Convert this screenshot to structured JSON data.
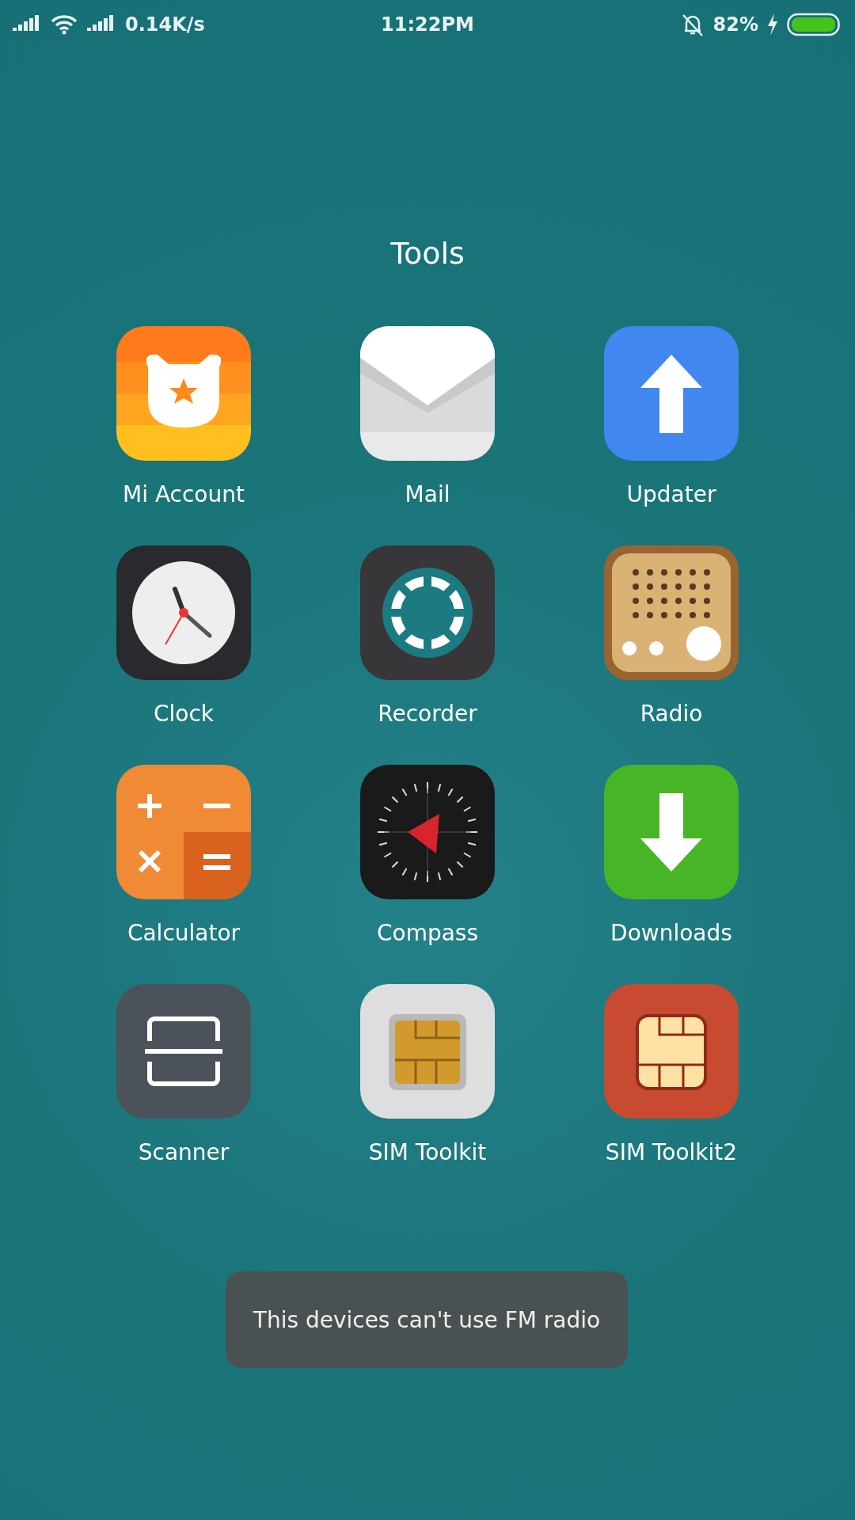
{
  "status_bar": {
    "speed": "0.14K/s",
    "time": "11:22PM",
    "battery": "82%"
  },
  "folder": {
    "title": "Tools"
  },
  "apps": [
    {
      "name": "Mi Account",
      "kind": "account"
    },
    {
      "name": "Mail",
      "kind": "mail"
    },
    {
      "name": "Updater",
      "kind": "updater"
    },
    {
      "name": "Clock",
      "kind": "clock"
    },
    {
      "name": "Recorder",
      "kind": "recorder"
    },
    {
      "name": "Radio",
      "kind": "radio"
    },
    {
      "name": "Calculator",
      "kind": "calculator"
    },
    {
      "name": "Compass",
      "kind": "compass"
    },
    {
      "name": "Downloads",
      "kind": "downloads"
    },
    {
      "name": "Scanner",
      "kind": "scanner"
    },
    {
      "name": "SIM Toolkit",
      "kind": "sim"
    },
    {
      "name": "SIM Toolkit2",
      "kind": "sim2"
    }
  ],
  "toast": "This devices can't use FM radio"
}
